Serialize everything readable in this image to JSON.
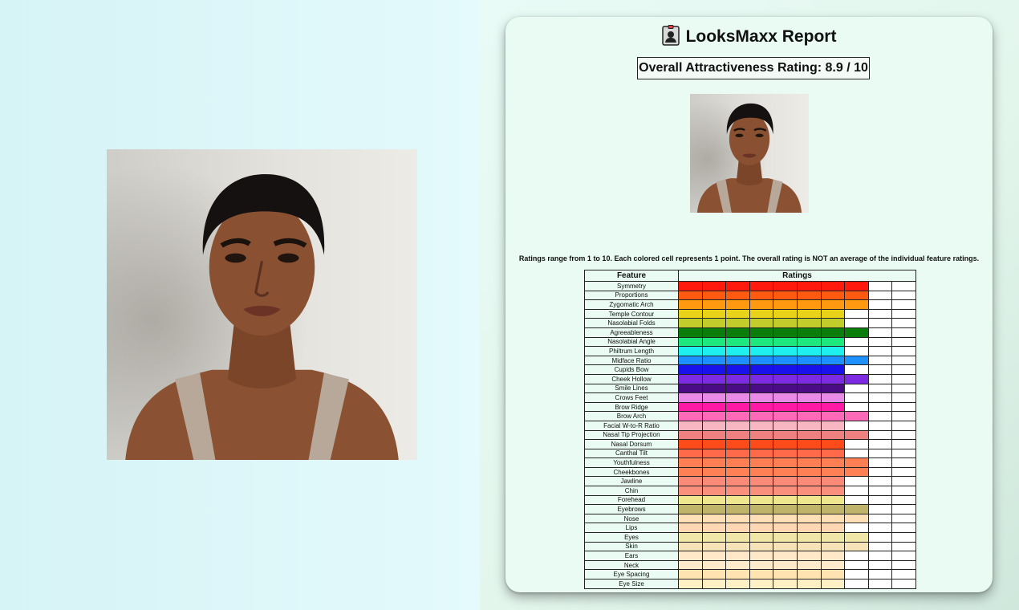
{
  "report": {
    "title": "LooksMaxx Report",
    "overall_label": "Overall Attractiveness Rating: 8.9 / 10",
    "note": "Ratings range from 1 to 10. Each colored cell represents 1 point. The overall rating is NOT an average of the individual feature ratings.",
    "table_headers": {
      "feature": "Feature",
      "ratings": "Ratings"
    },
    "max_points": 10,
    "features": [
      {
        "name": "Symmetry",
        "score": 8,
        "color": "#ff1a0d"
      },
      {
        "name": "Proportions",
        "score": 8,
        "color": "#ff5a10"
      },
      {
        "name": "Zygomatic Arch",
        "score": 8,
        "color": "#ff9a10"
      },
      {
        "name": "Temple Contour",
        "score": 7,
        "color": "#e8d21a"
      },
      {
        "name": "Nasolabial Folds",
        "score": 7,
        "color": "#c2cd2c"
      },
      {
        "name": "Agreeableness",
        "score": 8,
        "color": "#0a7d0a"
      },
      {
        "name": "Nasolabial Angle",
        "score": 7,
        "color": "#1ee87e"
      },
      {
        "name": "Philtrum Length",
        "score": 7,
        "color": "#1ef0f0"
      },
      {
        "name": "Midface Ratio",
        "score": 8,
        "color": "#1e90ff"
      },
      {
        "name": "Cupids Bow",
        "score": 7,
        "color": "#1a12ea"
      },
      {
        "name": "Cheek Hollow",
        "score": 8,
        "color": "#7c2be2"
      },
      {
        "name": "Smile Lines",
        "score": 7,
        "color": "#4b0a86"
      },
      {
        "name": "Crows Feet",
        "score": 7,
        "color": "#e88ae6"
      },
      {
        "name": "Brow Ridge",
        "score": 7,
        "color": "#ff1aa6"
      },
      {
        "name": "Brow Arch",
        "score": 8,
        "color": "#ff69b8"
      },
      {
        "name": "Facial W-to-R Ratio",
        "score": 7,
        "color": "#f7b6c2"
      },
      {
        "name": "Nasal Tip Projection",
        "score": 8,
        "color": "#ef8080"
      },
      {
        "name": "Nasal Dorsum",
        "score": 7,
        "color": "#ff4a1a"
      },
      {
        "name": "Canthal Tilt",
        "score": 7,
        "color": "#ff6a4a"
      },
      {
        "name": "Youthfulness",
        "score": 8,
        "color": "#ff7f55"
      },
      {
        "name": "Cheekbones",
        "score": 8,
        "color": "#ff8055"
      },
      {
        "name": "Jawline",
        "score": 7,
        "color": "#fb8a78"
      },
      {
        "name": "Chin",
        "score": 7,
        "color": "#f98f7c"
      },
      {
        "name": "Forehead",
        "score": 7,
        "color": "#efe68d"
      },
      {
        "name": "Eyebrows",
        "score": 8,
        "color": "#bfb46a"
      },
      {
        "name": "Nose",
        "score": 8,
        "color": "#ffdfb5"
      },
      {
        "name": "Lips",
        "score": 7,
        "color": "#ffd8b3"
      },
      {
        "name": "Eyes",
        "score": 8,
        "color": "#efe6a8"
      },
      {
        "name": "Skin",
        "score": 8,
        "color": "#f7e3b8"
      },
      {
        "name": "Ears",
        "score": 7,
        "color": "#ffe8c8"
      },
      {
        "name": "Neck",
        "score": 7,
        "color": "#ffeacb"
      },
      {
        "name": "Eye Spacing",
        "score": 7,
        "color": "#ffe3b0"
      },
      {
        "name": "Eye Size",
        "score": 7,
        "color": "#fff0c6"
      }
    ]
  }
}
